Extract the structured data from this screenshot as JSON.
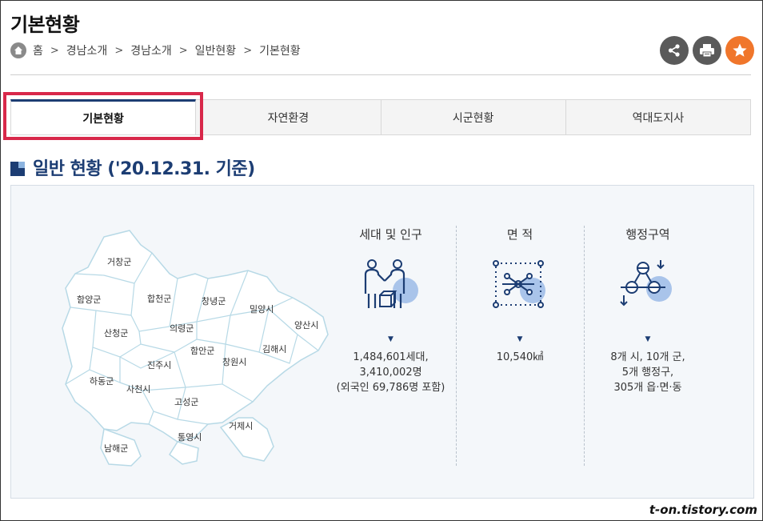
{
  "header": {
    "title": "기본현황",
    "breadcrumb": [
      "홈",
      "경남소개",
      "경남소개",
      "일반현황",
      "기본현황"
    ]
  },
  "actions": {
    "share_icon": "share-icon",
    "print_icon": "print-icon",
    "favorite_icon": "star-icon"
  },
  "tabs": [
    {
      "label": "기본현황",
      "active": true
    },
    {
      "label": "자연환경",
      "active": false
    },
    {
      "label": "시군현황",
      "active": false
    },
    {
      "label": "역대도지사",
      "active": false
    }
  ],
  "section": {
    "title": "일반 현황 ('20.12.31. 기준)"
  },
  "map": {
    "regions": [
      "거창군",
      "함양군",
      "합천군",
      "창녕군",
      "밀양시",
      "양산시",
      "산청군",
      "의령군",
      "함안군",
      "김해시",
      "진주시",
      "창원시",
      "하동군",
      "사천시",
      "고성군",
      "거제시",
      "통영시",
      "남해군"
    ]
  },
  "stats": [
    {
      "title": "세대 및 인구",
      "icon": "population-icon",
      "lines": [
        "1,484,601세대,",
        "3,410,002명",
        "(외국인 69,786명 포함)"
      ]
    },
    {
      "title": "면 적",
      "icon": "area-icon",
      "lines": [
        "10,540㎢"
      ]
    },
    {
      "title": "행정구역",
      "icon": "administrative-icon",
      "lines": [
        "8개 시, 10개 군,",
        "5개 행정구,",
        "305개 읍·면·동"
      ]
    }
  ],
  "colors": {
    "primary": "#1c3d73",
    "accent": "#f0762b",
    "highlight": "#d8284a",
    "icon_circle": "#a9c4ea"
  },
  "watermark": "t-on.tistory.com"
}
